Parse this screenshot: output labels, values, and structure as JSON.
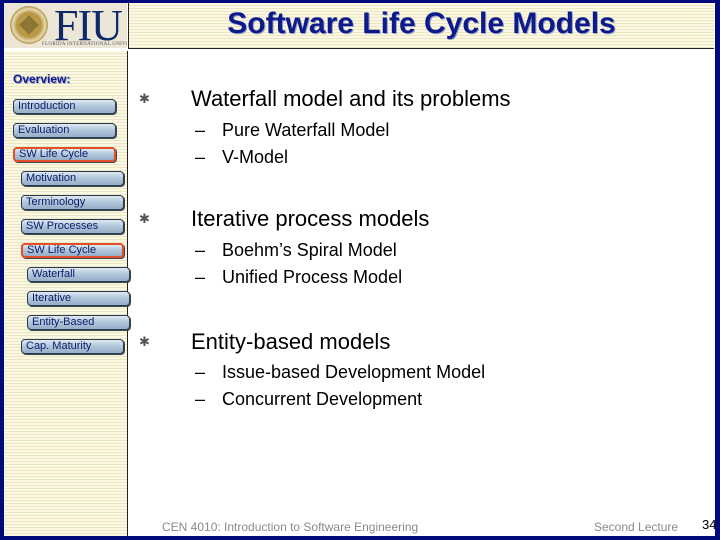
{
  "logo": {
    "text": "FIU",
    "subtext": "FLORIDA INTERNATIONAL UNIVERSITY"
  },
  "header": {
    "title": "Software Life Cycle Models"
  },
  "sidebar": {
    "heading": "Overview:",
    "items": [
      {
        "label": "Introduction",
        "active": false
      },
      {
        "label": "Evaluation",
        "active": false
      },
      {
        "label": "SW Life Cycle",
        "active": true
      },
      {
        "label": "Motivation",
        "active": false
      },
      {
        "label": "Terminology",
        "active": false
      },
      {
        "label": "SW Processes",
        "active": false
      },
      {
        "label": "SW Life Cycle",
        "active": true
      },
      {
        "label": "Waterfall",
        "active": false
      },
      {
        "label": "Iterative",
        "active": false
      },
      {
        "label": "Entity-Based",
        "active": false
      },
      {
        "label": "Cap. Maturity",
        "active": false
      }
    ]
  },
  "content": {
    "bullets": [
      {
        "text": "Waterfall model and its problems",
        "subitems": [
          "Pure Waterfall Model",
          "V-Model"
        ]
      },
      {
        "text": "Iterative process models",
        "subitems": [
          "Boehm’s Spiral Model",
          "Unified Process Model"
        ]
      },
      {
        "text": "Entity-based models",
        "subitems": [
          "Issue-based Development Model",
          "Concurrent Development"
        ]
      }
    ],
    "bullet_glyph": "✱",
    "dash_glyph": "–"
  },
  "footer": {
    "course": "CEN 4010: Introduction to Software Engineering",
    "lecture": "Second Lecture",
    "page_number": "34"
  },
  "colors": {
    "frame": "#000a7a",
    "title": "#0c1a8c",
    "active_outline": "#e0502a"
  }
}
